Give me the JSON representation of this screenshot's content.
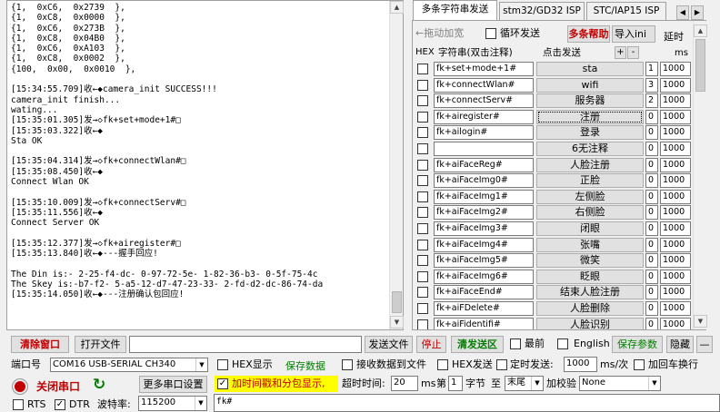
{
  "log": {
    "lines": [
      "{1,  0xC6,  0x2739  },",
      "{1,  0xC8,  0x0000  },",
      "{1,  0xC6,  0x273B  },",
      "{1,  0xC8,  0x04B0  },",
      "{1,  0xC6,  0xA103  },",
      "{1,  0xC8,  0x0002  },",
      "{100,  0x00,  0x0010  },",
      "",
      "[15:34:55.709]收←◆camera_init SUCCESS!!!",
      "camera_init finish...",
      "wating...",
      "[15:35:01.305]发→◇fk+set+mode+1#□",
      "[15:35:03.322]收←◆",
      "Sta OK",
      "",
      "[15:35:04.314]发→◇fk+connectWlan#□",
      "[15:35:08.450]收←◆",
      "Connect Wlan OK",
      "",
      "[15:35:10.009]发→◇fk+connectServ#□",
      "[15:35:11.556]收←◆",
      "Connect Server OK",
      "",
      "[15:35:12.377]发→◇fk+airegister#□",
      "[15:35:13.840]收←◆---握手回应!",
      "",
      "The Din is:- 2-25-f4-dc- 0-97-72-5e- 1-82-36-b3- 0-5f-75-4c",
      "The Skey is:-b7-f2- 5-a5-12-d7-47-23-33- 2-fd-d2-dc-86-74-da",
      "[15:35:14.050]收←◆---注册确认包回应!"
    ]
  },
  "tabs": [
    "多条字符串发送",
    "stm32/GD32 ISP",
    "STC/IAP15 ISP"
  ],
  "multi": {
    "drag_label": "←拖动加宽",
    "loop_label": "循环发送",
    "help_label": "多条帮助",
    "import_label": "导入ini",
    "delay_header": "延时",
    "hex_header": "HEX",
    "string_header": "字符串(双击注释)",
    "click_header": "点击发送",
    "plus": "+",
    "minus": "-",
    "ms_header": "ms",
    "rows": [
      {
        "str": "fk+set+mode+1#",
        "btn": "sta",
        "num": "1",
        "delay": "1000"
      },
      {
        "str": "fk+connectWlan#",
        "btn": "wifi",
        "num": "3",
        "delay": "1000"
      },
      {
        "str": "fk+connectServ#",
        "btn": "服务器",
        "num": "2",
        "delay": "1000"
      },
      {
        "str": "fk+airegister#",
        "btn": "注册",
        "num": "0",
        "delay": "1000"
      },
      {
        "str": "fk+ailogin#",
        "btn": "登录",
        "num": "0",
        "delay": "1000"
      },
      {
        "str": "",
        "btn": "6无注释",
        "num": "0",
        "delay": "1000"
      },
      {
        "str": "fk+aiFaceReg#",
        "btn": "人脸注册",
        "num": "0",
        "delay": "1000"
      },
      {
        "str": "fk+aiFaceImg0#",
        "btn": "正脸",
        "num": "0",
        "delay": "1000"
      },
      {
        "str": "fk+aiFaceImg1#",
        "btn": "左侧脸",
        "num": "0",
        "delay": "1000"
      },
      {
        "str": "fk+aiFaceImg2#",
        "btn": "右侧脸",
        "num": "0",
        "delay": "1000"
      },
      {
        "str": "fk+aiFaceImg3#",
        "btn": "闭眼",
        "num": "0",
        "delay": "1000"
      },
      {
        "str": "fk+aiFaceImg4#",
        "btn": "张嘴",
        "num": "0",
        "delay": "1000"
      },
      {
        "str": "fk+aiFaceImg5#",
        "btn": "微笑",
        "num": "0",
        "delay": "1000"
      },
      {
        "str": "fk+aiFaceImg6#",
        "btn": "眨眼",
        "num": "0",
        "delay": "1000"
      },
      {
        "str": "fk+aiFaceEnd#",
        "btn": "结束人脸注册",
        "num": "0",
        "delay": "1000"
      },
      {
        "str": "fk+aiFDelete#",
        "btn": "人脸删除",
        "num": "0",
        "delay": "1000"
      },
      {
        "str": "fk+aiFidentifi#",
        "btn": "人脸识别",
        "num": "0",
        "delay": "1000"
      }
    ]
  },
  "toolbar": {
    "clear_label": "清除窗口",
    "open_file_label": "打开文件",
    "file_path": "",
    "send_file_label": "发送文件",
    "stop_label": "停止",
    "clear_send_label": "清发送区",
    "topmost_label": "最前",
    "english_label": "English",
    "save_params_label": "保存参数",
    "hide_label": "隐藏",
    "dash_label": "—"
  },
  "port": {
    "port_label": "端口号",
    "port_value": "COM16 USB-SERIAL CH340",
    "more_settings_label": "更多串口设置",
    "close_port_label": "关闭串口",
    "rts_label": "RTS",
    "dtr_label": "DTR",
    "baud_label": "波特率:",
    "baud_value": "115200"
  },
  "recv": {
    "hex_display_label": "HEX显示",
    "save_data_label": "保存数据",
    "recv_to_file_label": "接收数据到文件",
    "timestamp_label": "加时间戳和分包显示,",
    "timeout_label": "超时时间:",
    "timeout_value": "20",
    "ms_label": "ms",
    "page_label": "第",
    "page_value": "1",
    "byte_label": "字节",
    "to_label": "至",
    "end_value": "末尾",
    "checksum_label": "加校验",
    "checksum_value": "None"
  },
  "send": {
    "hex_send_label": "HEX发送",
    "timed_send_label": "定时发送:",
    "interval_value": "1000",
    "interval_unit": "ms/次",
    "crlf_label": "加回车换行",
    "input_value": "fk#"
  }
}
